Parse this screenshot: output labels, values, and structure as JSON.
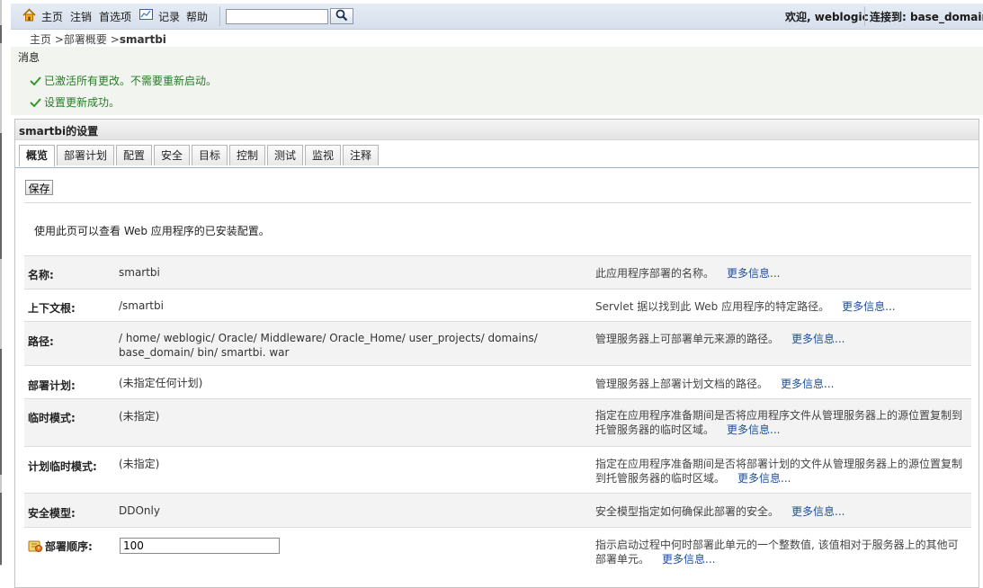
{
  "topbar": {
    "home": "主页",
    "logout": "注销",
    "preferences": "首选项",
    "record": "记录",
    "help": "帮助",
    "search_value": "",
    "welcome": "欢迎, weblogic",
    "connected": "连接到: base_domain"
  },
  "breadcrumb": {
    "home": "主页",
    "deployments": "部署概要",
    "current": "smartbi",
    "sep": ">"
  },
  "messages": {
    "title": "消息",
    "items": [
      "已激活所有更改。不需要重新启动。",
      "设置更新成功。"
    ]
  },
  "panel": {
    "title": "smartbi的设置",
    "tabs": [
      "概览",
      "部署计划",
      "配置",
      "安全",
      "目标",
      "控制",
      "测试",
      "监视",
      "注释"
    ],
    "save_label": "保存",
    "description": "使用此页可以查看 Web 应用程序的已安装配置。",
    "more_info": "更多信息...",
    "rows": [
      {
        "label": "名称:",
        "value": "smartbi",
        "help": "此应用程序部署的名称。"
      },
      {
        "label": "上下文根:",
        "value": "/smartbi",
        "help": "Servlet 据以找到此 Web 应用程序的特定路径。"
      },
      {
        "label": "路径:",
        "value": "/ home/ weblogic/ Oracle/ Middleware/ Oracle_Home/ user_projects/ domains/ base_domain/ bin/ smartbi. war",
        "help": "管理服务器上可部署单元来源的路径。"
      },
      {
        "label": "部署计划:",
        "value": "(未指定任何计划)",
        "help": "管理服务器上部署计划文档的路径。"
      },
      {
        "label": "临时模式:",
        "value": "(未指定)",
        "help": "指定在应用程序准备期间是否将应用程序文件从管理服务器上的源位置复制到托管服务器的临时区域。"
      },
      {
        "label": "计划临时模式:",
        "value": "(未指定)",
        "help": "指定在应用程序准备期间是否将部署计划的文件从管理服务器上的源位置复制到托管服务器的临时区域。"
      },
      {
        "label": "安全模型:",
        "value": "DDOnly",
        "help": "安全模型指定如何确保此部署的安全。"
      },
      {
        "label": "部署顺序:",
        "value": "100",
        "help": "指示启动过程中何时部署此单元的一个整数值, 该值相对于服务器上的其他可部署单元。"
      }
    ]
  }
}
